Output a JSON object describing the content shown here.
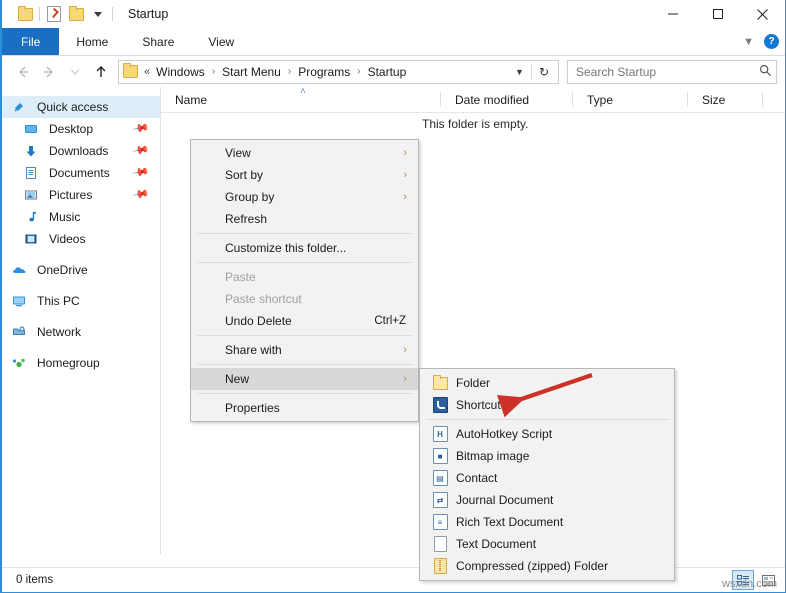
{
  "window": {
    "title": "Startup",
    "quick_access_toolbar": [
      "folder-icon",
      "properties-icon",
      "folder-icon",
      "dropdown-caret"
    ],
    "controls": {
      "minimize": "minimize-icon",
      "maximize": "maximize-icon",
      "close": "close-icon"
    }
  },
  "ribbon": {
    "tabs": [
      {
        "label": "File",
        "active_blue": true
      },
      {
        "label": "Home",
        "active_blue": false
      },
      {
        "label": "Share",
        "active_blue": false
      },
      {
        "label": "View",
        "active_blue": false
      }
    ],
    "collapse_chevron": "chevron-down-icon",
    "help": "?"
  },
  "address_bar": {
    "back": "back-arrow-icon",
    "forward": "forward-arrow-icon",
    "recent": "recent-caret-icon",
    "up": "up-arrow-icon",
    "leading": "«",
    "breadcrumbs": [
      "Windows",
      "Start Menu",
      "Programs",
      "Startup"
    ],
    "separator": "›",
    "dropdown": "chevron-down-icon",
    "refresh": "↻"
  },
  "search": {
    "placeholder": "Search Startup",
    "icon": "search-icon"
  },
  "sidebar": {
    "items": [
      {
        "label": "Quick access",
        "icon": "pin-star-icon",
        "selected": true,
        "indent": false,
        "pinned": false,
        "group_gap": false
      },
      {
        "label": "Desktop",
        "icon": "desktop-icon",
        "selected": false,
        "indent": true,
        "pinned": true,
        "group_gap": false
      },
      {
        "label": "Downloads",
        "icon": "download-icon",
        "selected": false,
        "indent": true,
        "pinned": true,
        "group_gap": false
      },
      {
        "label": "Documents",
        "icon": "documents-icon",
        "selected": false,
        "indent": true,
        "pinned": true,
        "group_gap": false
      },
      {
        "label": "Pictures",
        "icon": "pictures-icon",
        "selected": false,
        "indent": true,
        "pinned": true,
        "group_gap": false
      },
      {
        "label": "Music",
        "icon": "music-icon",
        "selected": false,
        "indent": true,
        "pinned": false,
        "group_gap": false
      },
      {
        "label": "Videos",
        "icon": "videos-icon",
        "selected": false,
        "indent": true,
        "pinned": false,
        "group_gap": false
      },
      {
        "label": "OneDrive",
        "icon": "onedrive-icon",
        "selected": false,
        "indent": false,
        "pinned": false,
        "group_gap": true
      },
      {
        "label": "This PC",
        "icon": "thispc-icon",
        "selected": false,
        "indent": false,
        "pinned": false,
        "group_gap": true
      },
      {
        "label": "Network",
        "icon": "network-icon",
        "selected": false,
        "indent": false,
        "pinned": false,
        "group_gap": true
      },
      {
        "label": "Homegroup",
        "icon": "homegroup-icon",
        "selected": false,
        "indent": false,
        "pinned": false,
        "group_gap": true
      }
    ]
  },
  "file_list": {
    "columns": [
      {
        "label": "Name",
        "sorted": true,
        "sort_caret": "˄"
      },
      {
        "label": "Date modified",
        "sorted": false
      },
      {
        "label": "Type",
        "sorted": false
      },
      {
        "label": "Size",
        "sorted": false
      }
    ],
    "empty_message": "This folder is empty."
  },
  "context_menu": {
    "items": [
      {
        "label": "View",
        "submenu": true,
        "disabled": false,
        "highlighted": false,
        "accel": "",
        "sep_after": false
      },
      {
        "label": "Sort by",
        "submenu": true,
        "disabled": false,
        "highlighted": false,
        "accel": "",
        "sep_after": false
      },
      {
        "label": "Group by",
        "submenu": true,
        "disabled": false,
        "highlighted": false,
        "accel": "",
        "sep_after": false
      },
      {
        "label": "Refresh",
        "submenu": false,
        "disabled": false,
        "highlighted": false,
        "accel": "",
        "sep_after": true
      },
      {
        "label": "Customize this folder...",
        "submenu": false,
        "disabled": false,
        "highlighted": false,
        "accel": "",
        "sep_after": true
      },
      {
        "label": "Paste",
        "submenu": false,
        "disabled": true,
        "highlighted": false,
        "accel": "",
        "sep_after": false
      },
      {
        "label": "Paste shortcut",
        "submenu": false,
        "disabled": true,
        "highlighted": false,
        "accel": "",
        "sep_after": false
      },
      {
        "label": "Undo Delete",
        "submenu": false,
        "disabled": false,
        "highlighted": false,
        "accel": "Ctrl+Z",
        "sep_after": true
      },
      {
        "label": "Share with",
        "submenu": true,
        "disabled": false,
        "highlighted": false,
        "accel": "",
        "sep_after": true
      },
      {
        "label": "New",
        "submenu": true,
        "disabled": false,
        "highlighted": true,
        "accel": "",
        "sep_after": true
      },
      {
        "label": "Properties",
        "submenu": false,
        "disabled": false,
        "highlighted": false,
        "accel": "",
        "sep_after": false
      }
    ],
    "submenu_arrow": "›"
  },
  "new_submenu": {
    "items": [
      {
        "label": "Folder",
        "icon": "folder-icon",
        "sep_after": false
      },
      {
        "label": "Shortcut",
        "icon": "shortcut-icon",
        "sep_after": true
      },
      {
        "label": "AutoHotkey Script",
        "icon": "autohotkey-icon",
        "sep_after": false
      },
      {
        "label": "Bitmap image",
        "icon": "bitmap-icon",
        "sep_after": false
      },
      {
        "label": "Contact",
        "icon": "contact-icon",
        "sep_after": false
      },
      {
        "label": "Journal Document",
        "icon": "journal-icon",
        "sep_after": false
      },
      {
        "label": "Rich Text Document",
        "icon": "richtext-icon",
        "sep_after": false
      },
      {
        "label": "Text Document",
        "icon": "textdoc-icon",
        "sep_after": false
      },
      {
        "label": "Compressed (zipped) Folder",
        "icon": "zip-folder-icon",
        "sep_after": false
      }
    ]
  },
  "annotation": {
    "type": "red-arrow",
    "points_to": "Shortcut",
    "color": "#cc3228"
  },
  "status_bar": {
    "items_text": "0 items",
    "view_details_icon": "details-view-icon",
    "view_tiles_icon": "tiles-view-icon"
  },
  "watermark": {
    "text": "wsxdn.com"
  },
  "colors": {
    "accent_blue": "#186fc4",
    "window_border": "#2b8ed6",
    "selection": "#ddeef8",
    "menu_bg": "#f2f2f2",
    "menu_highlight": "#d8d8d8",
    "arrow_red": "#cc3228"
  }
}
